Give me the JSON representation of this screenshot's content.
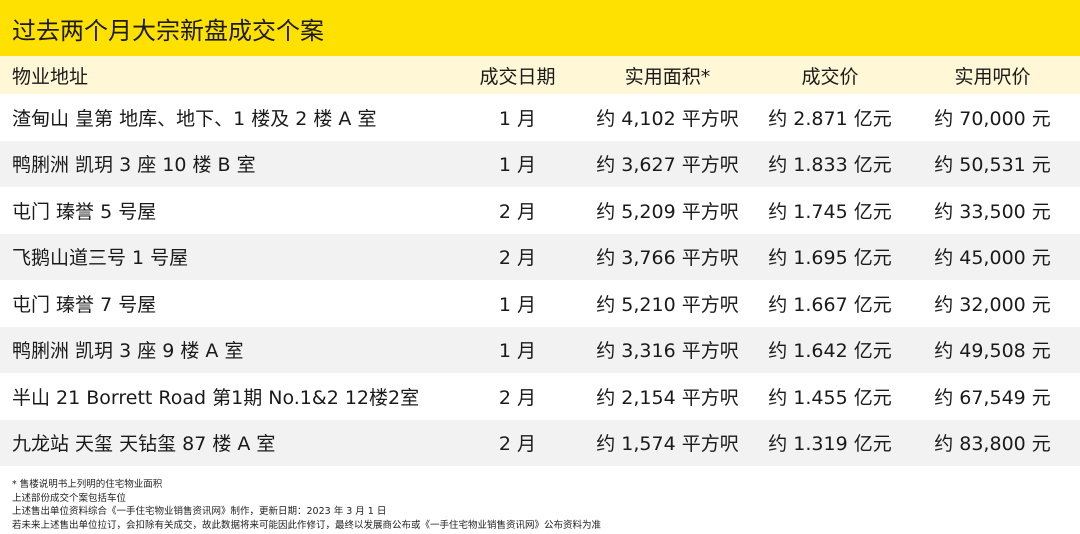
{
  "title": "过去两个月大宗新盘成交个案",
  "table": {
    "headers": [
      "物业地址",
      "成交日期",
      "实用面积*",
      "成交价",
      "实用呎价"
    ],
    "rows": [
      [
        "渣甸山 皇第 地库、地下、1 楼及 2 楼 A 室",
        "1 月",
        "约 4,102 平方呎",
        "约 2.871 亿元",
        "约 70,000 元"
      ],
      [
        "鸭脷洲 凯玥 3 座 10 楼 B 室",
        "1 月",
        "约 3,627 平方呎",
        "约 1.833 亿元",
        "约 50,531 元"
      ],
      [
        "屯门 瑧誉 5 号屋",
        "2 月",
        "约 5,209 平方呎",
        "约 1.745 亿元",
        "约 33,500 元"
      ],
      [
        "飞鹅山道三号 1 号屋",
        "2 月",
        "约 3,766 平方呎",
        "约 1.695 亿元",
        "约 45,000 元"
      ],
      [
        "屯门 瑧誉 7 号屋",
        "1 月",
        "约 5,210 平方呎",
        "约 1.667 亿元",
        "约 32,000 元"
      ],
      [
        "鸭脷洲 凯玥 3 座 9 楼 A 室",
        "1 月",
        "约 3,316 平方呎",
        "约 1.642 亿元",
        "约 49,508 元"
      ],
      [
        "半山 21 Borrett Road 第1期 No.1&2 12楼2室",
        "2 月",
        "约 2,154 平方呎",
        "约 1.455 亿元",
        "约 67,549 元"
      ],
      [
        "九龙站 天玺 天钻玺 87 楼 A 室",
        "2 月",
        "约 1,574 平方呎",
        "约 1.319 亿元",
        "约 83,800 元"
      ]
    ]
  },
  "notes": [
    "* 售楼说明书上列明的住宅物业面积",
    "上述部份成交个案包括车位",
    "上述售出单位资料综合《一手住宅物业销售资讯网》制作，更新日期：2023 年 3 月 1 日",
    "若未来上述售出单位拉订，会扣除有关成交，故此数据将来可能因此作修订，最终以发展商公布或《一手住宅物业销售资讯网》公布资料为准"
  ],
  "colors": {
    "title_bg": "#ffe100",
    "header_bg": "#fff7d6",
    "zebra_bg": "#f2f2f2"
  }
}
